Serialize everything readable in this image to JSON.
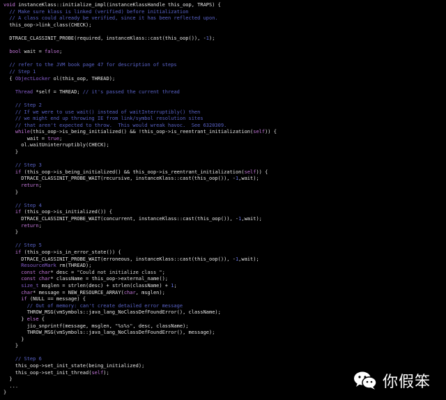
{
  "code_lines": [
    [
      {
        "t": "void ",
        "c": "kw"
      },
      {
        "t": "instanceKlass::initialize_impl(instanceKlassHandle this_oop, TRAPS) {",
        "c": ""
      }
    ],
    [
      {
        "t": "  // Make sure klass is linked (verified) before initialization",
        "c": "cm"
      }
    ],
    [
      {
        "t": "  // A class could already be verified, since it has been reflected upon.",
        "c": "cm"
      }
    ],
    [
      {
        "t": "  this_oop->link_class(CHECK);",
        "c": ""
      }
    ],
    [],
    [
      {
        "t": "  DTRACE_CLASSINIT_PROBE(required, instanceKlass::cast(this_oop()), -",
        "c": ""
      },
      {
        "t": "1",
        "c": "nm"
      },
      {
        "t": ");",
        "c": ""
      }
    ],
    [],
    [
      {
        "t": "  bool ",
        "c": "kw"
      },
      {
        "t": "wait = ",
        "c": ""
      },
      {
        "t": "false",
        "c": "kw"
      },
      {
        "t": ";",
        "c": ""
      }
    ],
    [],
    [
      {
        "t": "  // refer to the JVM book page 47 for description of steps",
        "c": "cm"
      }
    ],
    [
      {
        "t": "  // Step 1",
        "c": "cm"
      }
    ],
    [
      {
        "t": "  { ",
        "c": ""
      },
      {
        "t": "ObjectLocker ",
        "c": "ty"
      },
      {
        "t": "ol(this_oop, THREAD);",
        "c": ""
      }
    ],
    [],
    [
      {
        "t": "    Thread ",
        "c": "ty"
      },
      {
        "t": "*self = THREAD; ",
        "c": ""
      },
      {
        "t": "// it's passed the current thread",
        "c": "cm"
      }
    ],
    [],
    [
      {
        "t": "    // Step 2",
        "c": "cm"
      }
    ],
    [
      {
        "t": "    // If we were to use wait() instead of waitInterruptibly() then",
        "c": "cm"
      }
    ],
    [
      {
        "t": "    // we might end up throwing IE from link/symbol resolution sites",
        "c": "cm"
      }
    ],
    [
      {
        "t": "    // that aren't expected to throw.  This would wreak havoc.  See 6320309.",
        "c": "cm"
      }
    ],
    [
      {
        "t": "    while",
        "c": "kw"
      },
      {
        "t": "(this_oop->is_being_initialized() && !this_oop->is_reentrant_initialization(",
        "c": ""
      },
      {
        "t": "self",
        "c": "kw"
      },
      {
        "t": ")) {",
        "c": ""
      }
    ],
    [
      {
        "t": "        wait = ",
        "c": ""
      },
      {
        "t": "true",
        "c": "kw"
      },
      {
        "t": ";",
        "c": ""
      }
    ],
    [
      {
        "t": "      ol.waitUninterruptibly(CHECK);",
        "c": ""
      }
    ],
    [
      {
        "t": "    }",
        "c": ""
      }
    ],
    [],
    [
      {
        "t": "    // Step 3",
        "c": "cm"
      }
    ],
    [
      {
        "t": "    if ",
        "c": "kw"
      },
      {
        "t": "(this_oop->is_being_initialized() && this_oop->is_reentrant_initialization(",
        "c": ""
      },
      {
        "t": "self",
        "c": "kw"
      },
      {
        "t": ")) {",
        "c": ""
      }
    ],
    [
      {
        "t": "      DTRACE_CLASSINIT_PROBE_WAIT(recursive, instanceKlass::cast(this_oop()), -",
        "c": ""
      },
      {
        "t": "1",
        "c": "nm"
      },
      {
        "t": ",wait);",
        "c": ""
      }
    ],
    [
      {
        "t": "      return",
        "c": "kw"
      },
      {
        "t": ";",
        "c": ""
      }
    ],
    [
      {
        "t": "    }",
        "c": ""
      }
    ],
    [],
    [
      {
        "t": "    // Step 4",
        "c": "cm"
      }
    ],
    [
      {
        "t": "    if ",
        "c": "kw"
      },
      {
        "t": "(this_oop->is_initialized()) {",
        "c": ""
      }
    ],
    [
      {
        "t": "      DTRACE_CLASSINIT_PROBE_WAIT(concurrent, instanceKlass::cast(this_oop()), -",
        "c": ""
      },
      {
        "t": "1",
        "c": "nm"
      },
      {
        "t": ",wait);",
        "c": ""
      }
    ],
    [
      {
        "t": "      return",
        "c": "kw"
      },
      {
        "t": ";",
        "c": ""
      }
    ],
    [
      {
        "t": "    }",
        "c": ""
      }
    ],
    [],
    [
      {
        "t": "    // Step 5",
        "c": "cm"
      }
    ],
    [
      {
        "t": "    if ",
        "c": "kw"
      },
      {
        "t": "(this_oop->is_in_error_state()) {",
        "c": ""
      }
    ],
    [
      {
        "t": "      DTRACE_CLASSINIT_PROBE_WAIT(erroneous, instanceKlass::cast(this_oop()), -",
        "c": ""
      },
      {
        "t": "1",
        "c": "nm"
      },
      {
        "t": ",wait);",
        "c": ""
      }
    ],
    [
      {
        "t": "      ResourceMark ",
        "c": "ty"
      },
      {
        "t": "rm(THREAD);",
        "c": ""
      }
    ],
    [
      {
        "t": "      const char",
        "c": "kw"
      },
      {
        "t": "* desc = ",
        "c": ""
      },
      {
        "t": "\"Could not initialize class \"",
        "c": "st"
      },
      {
        "t": ";",
        "c": ""
      }
    ],
    [
      {
        "t": "      const char",
        "c": "kw"
      },
      {
        "t": "* className = this_oop->external_name();",
        "c": ""
      }
    ],
    [
      {
        "t": "      size_t ",
        "c": "ty"
      },
      {
        "t": "msglen = strlen(desc) + strlen(className) + ",
        "c": ""
      },
      {
        "t": "1",
        "c": "nm"
      },
      {
        "t": ";",
        "c": ""
      }
    ],
    [
      {
        "t": "      char",
        "c": "kw"
      },
      {
        "t": "* message = NEW_RESOURCE_ARRAY(",
        "c": ""
      },
      {
        "t": "char",
        "c": "kw"
      },
      {
        "t": ", msglen);",
        "c": ""
      }
    ],
    [
      {
        "t": "      if ",
        "c": "kw"
      },
      {
        "t": "(NULL == message) {",
        "c": ""
      }
    ],
    [
      {
        "t": "        // Out of memory: can't create detailed error message",
        "c": "cm"
      }
    ],
    [
      {
        "t": "        THROW_MSG(vmSymbols::java_lang_NoClassDefFoundError(), className);",
        "c": ""
      }
    ],
    [
      {
        "t": "      } ",
        "c": ""
      },
      {
        "t": "else ",
        "c": "kw"
      },
      {
        "t": "{",
        "c": ""
      }
    ],
    [
      {
        "t": "        jio_snprintf(message, msglen, ",
        "c": ""
      },
      {
        "t": "\"%s%s\"",
        "c": "st"
      },
      {
        "t": ", desc, className);",
        "c": ""
      }
    ],
    [
      {
        "t": "        THROW_MSG(vmSymbols::java_lang_NoClassDefFoundError(), message);",
        "c": ""
      }
    ],
    [
      {
        "t": "      }",
        "c": ""
      }
    ],
    [
      {
        "t": "    }",
        "c": ""
      }
    ],
    [],
    [
      {
        "t": "    // Step 6",
        "c": "cm"
      }
    ],
    [
      {
        "t": "    this_oop->set_init_state(being_initialized);",
        "c": ""
      }
    ],
    [
      {
        "t": "    this_oop->set_init_thread(",
        "c": ""
      },
      {
        "t": "self",
        "c": "kw"
      },
      {
        "t": ");",
        "c": ""
      }
    ],
    [
      {
        "t": "  }",
        "c": ""
      }
    ],
    [
      {
        "t": "  ...",
        "c": ""
      }
    ],
    [
      {
        "t": "}",
        "c": ""
      }
    ]
  ],
  "watermark": {
    "text": "你假笨",
    "icon": "wechat-icon"
  }
}
